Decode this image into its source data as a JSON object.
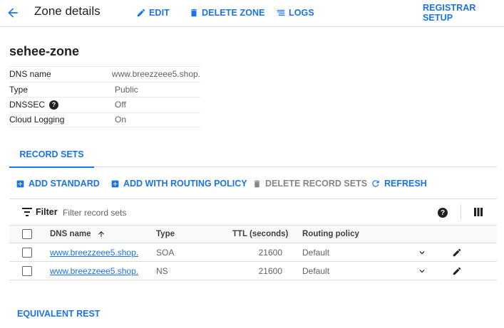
{
  "header": {
    "title": "Zone details",
    "edit_label": "EDIT",
    "delete_zone_label": "DELETE ZONE",
    "logs_label": "LOGS",
    "registrar_setup_label": "REGISTRAR SETUP"
  },
  "zone": {
    "name": "sehee-zone",
    "properties": [
      {
        "label": "DNS name",
        "value": "www.breezzeee5.shop."
      },
      {
        "label": "Type",
        "value": "Public"
      },
      {
        "label": "DNSSEC",
        "value": "Off"
      },
      {
        "label": "Cloud Logging",
        "value": "On"
      }
    ]
  },
  "tabs": [
    {
      "label": "RECORD SETS",
      "active": true
    }
  ],
  "actions": {
    "add_standard": "ADD STANDARD",
    "add_routing_policy": "ADD WITH ROUTING POLICY",
    "delete_record_sets": "DELETE RECORD SETS",
    "refresh": "REFRESH"
  },
  "filter": {
    "label": "Filter",
    "placeholder": "Filter record sets"
  },
  "table": {
    "columns": {
      "dns_name": "DNS name",
      "type": "Type",
      "ttl": "TTL (seconds)",
      "routing_policy": "Routing policy"
    },
    "rows": [
      {
        "dns_name": "www.breezzeee5.shop.",
        "type": "SOA",
        "ttl": "21600",
        "routing_policy": "Default"
      },
      {
        "dns_name": "www.breezzeee5.shop.",
        "type": "NS",
        "ttl": "21600",
        "routing_policy": "Default"
      }
    ]
  },
  "footer": {
    "equivalent_rest": "EQUIVALENT REST"
  },
  "colors": {
    "accent": "#1a73e8",
    "text": "#202124",
    "muted": "#5f6368",
    "divider": "#dadce0"
  }
}
